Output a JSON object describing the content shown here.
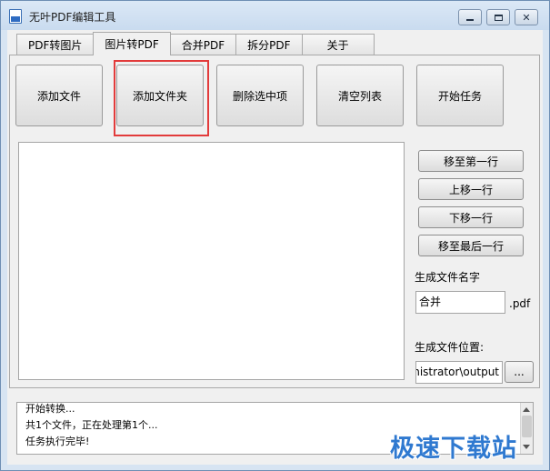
{
  "window": {
    "title": "无叶PDF编辑工具",
    "min_label": "",
    "max_label": "",
    "close_label": "✕"
  },
  "tabs": [
    {
      "label": "PDF转图片",
      "active": false
    },
    {
      "label": "图片转PDF",
      "active": true
    },
    {
      "label": "合并PDF",
      "active": false
    },
    {
      "label": "拆分PDF",
      "active": false
    },
    {
      "label": "关于",
      "active": false
    }
  ],
  "toolbar": {
    "add_file": "添加文件",
    "add_folder": "添加文件夹",
    "delete_selected": "删除选中项",
    "clear_list": "清空列表",
    "start_task": "开始任务"
  },
  "file_list": {
    "items": []
  },
  "side_buttons": {
    "move_top": "移至第一行",
    "move_up": "上移一行",
    "move_down": "下移一行",
    "move_bottom": "移至最后一行"
  },
  "output": {
    "name_label": "生成文件名字",
    "name_value": "合并",
    "name_suffix": ".pdf",
    "location_label": "生成文件位置:",
    "location_value": "ministrator\\output",
    "browse_label": "..."
  },
  "log": [
    "开始转换...",
    "共1个文件，正在处理第1个...",
    "任务执行完毕!"
  ],
  "watermark": "极速下载站",
  "colors": {
    "highlight": "#e23b3b",
    "watermark": "#2f79d0"
  }
}
